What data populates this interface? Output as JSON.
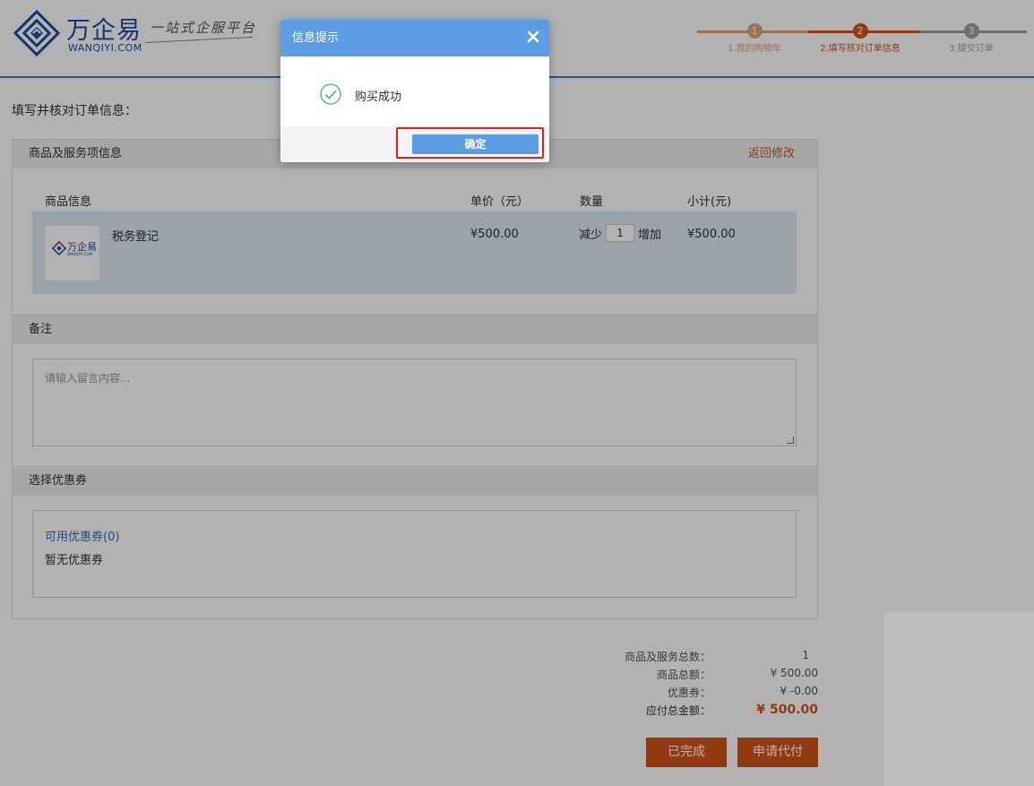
{
  "header": {
    "brand_name": "万企易",
    "brand_domain": "WANQIYI.COM",
    "slogan": "一站式企服平台",
    "steps": [
      {
        "num": "1",
        "label": "1.我的购物车",
        "state": "done"
      },
      {
        "num": "2",
        "label": "2.填写核对订单信息",
        "state": "active"
      },
      {
        "num": "3",
        "label": "3.提交订单",
        "state": "pending"
      }
    ]
  },
  "page": {
    "heading": "填写并核对订单信息："
  },
  "products_panel": {
    "title": "商品及服务项信息",
    "back_link": "返回修改",
    "columns": {
      "info": "商品信息",
      "unit_price": "单价（元）",
      "quantity": "数量",
      "subtotal": "小计(元)"
    },
    "item": {
      "thumb_brand": "万企易",
      "thumb_domain": "WANQIYI.COM",
      "name": "税务登记",
      "price": "¥500.00",
      "qty_decrease": "减少",
      "qty": "1",
      "qty_increase": "增加",
      "subtotal": "¥500.00"
    }
  },
  "remark_panel": {
    "title": "备注",
    "placeholder": "请输入留言内容..."
  },
  "coupon_panel": {
    "title": "选择优惠券",
    "tab": "可用优惠券(0)",
    "empty": "暂无优惠券"
  },
  "summary": {
    "count_label": "商品及服务总数：",
    "count_value": "1",
    "goods_label": "商品总额：",
    "goods_value": "¥ 500.00",
    "coupon_label": "优惠券：",
    "coupon_value": "¥ -0.00",
    "total_label": "应付总金额：",
    "total_value": "¥ 500.00"
  },
  "actions": {
    "done": "已完成",
    "apply_pay": "申请代付"
  },
  "modal": {
    "title": "信息提示",
    "message": "购买成功",
    "confirm": "确定"
  },
  "colors": {
    "brand_blue": "#1f4e9a",
    "accent_orange": "#d4541c",
    "modal_blue": "#5c9de6",
    "success_green": "#3cb371",
    "highlight_red": "#e02020"
  }
}
